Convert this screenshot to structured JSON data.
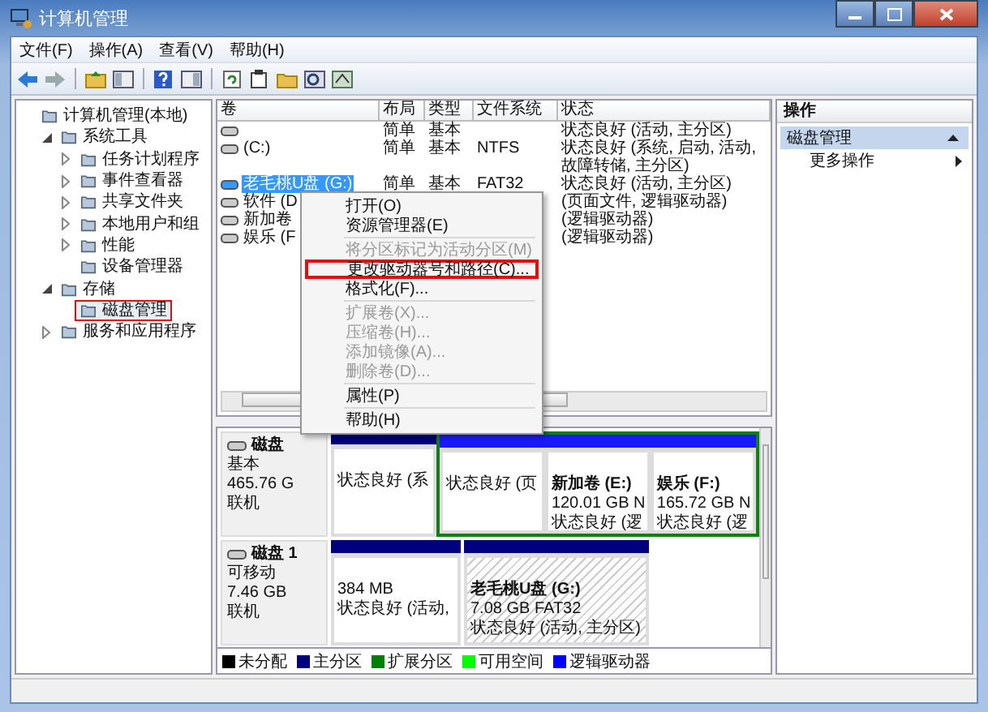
{
  "window": {
    "title": "计算机管理"
  },
  "menu_bar": [
    "文件(F)",
    "操作(A)",
    "查看(V)",
    "帮助(H)"
  ],
  "tree": [
    {
      "label": "计算机管理(本地)",
      "selected": false,
      "children": [
        {
          "label": "系统工具",
          "expanded": true,
          "selected": false,
          "children": [
            {
              "label": "任务计划程序",
              "expanded": false,
              "selected": false
            },
            {
              "label": "事件查看器",
              "expanded": false,
              "selected": false
            },
            {
              "label": "共享文件夹",
              "expanded": false,
              "selected": false
            },
            {
              "label": "本地用户和组",
              "expanded": false,
              "selected": false
            },
            {
              "label": "性能",
              "expanded": false,
              "selected": false
            },
            {
              "label": "设备管理器",
              "selected": false
            }
          ]
        },
        {
          "label": "存储",
          "expanded": true,
          "selected": false,
          "children": [
            {
              "label": "磁盘管理",
              "selected": true
            }
          ]
        },
        {
          "label": "服务和应用程序",
          "expanded": false,
          "selected": false
        }
      ]
    }
  ],
  "volume_table": {
    "columns": [
      "卷",
      "布局",
      "类型",
      "文件系统",
      "状态"
    ],
    "rows": [
      {
        "layout": "简单",
        "type": "基本",
        "status": "状态良好 (活动, 主分区)",
        "selected": false
      },
      {
        "volume": "(C:)",
        "layout": "简单",
        "type": "基本",
        "file_system": "NTFS",
        "status": "状态良好 (系统, 启动, 活动, 故障转储, 主分区)",
        "selected": false
      },
      {
        "volume": "老毛桃U盘 (G:)",
        "layout": "简单",
        "type": "基本",
        "file_system": "FAT32",
        "status": "状态良好 (活动, 主分区)",
        "selected": true
      },
      {
        "volume": "软件 (D",
        "status": "(页面文件, 逻辑驱动器)",
        "selected": false
      },
      {
        "volume": "新加卷",
        "status": "(逻辑驱动器)",
        "selected": false
      },
      {
        "volume": "娱乐 (F",
        "status": "(逻辑驱动器)",
        "selected": false
      }
    ]
  },
  "context_menu": {
    "groups": [
      [
        {
          "label": "打开(O)",
          "disabled": false,
          "highlighted": false
        },
        {
          "label": "资源管理器(E)",
          "disabled": false,
          "highlighted": false
        }
      ],
      [
        {
          "label": "将分区标记为活动分区(M)",
          "disabled": true,
          "highlighted": false
        },
        {
          "label": "更改驱动器号和路径(C)...",
          "disabled": false,
          "highlighted": true
        },
        {
          "label": "格式化(F)...",
          "disabled": false,
          "highlighted": false
        }
      ],
      [
        {
          "label": "扩展卷(X)...",
          "disabled": true,
          "highlighted": false
        },
        {
          "label": "压缩卷(H)...",
          "disabled": true,
          "highlighted": false
        },
        {
          "label": "添加镜像(A)...",
          "disabled": true,
          "highlighted": false
        },
        {
          "label": "删除卷(D)...",
          "disabled": true,
          "highlighted": false
        }
      ],
      [
        {
          "label": "属性(P)",
          "disabled": false,
          "highlighted": false
        }
      ],
      [
        {
          "label": "帮助(H)",
          "disabled": false,
          "highlighted": false
        }
      ]
    ]
  },
  "disks": [
    {
      "name": "磁盘",
      "type": "基本",
      "size": "465.76 G",
      "status": "联机",
      "partitions": [
        {
          "kind": "primary",
          "selected": false,
          "lines": [
            "状态良好 (系"
          ]
        },
        {
          "kind": "logical",
          "selected": false,
          "lines": [
            "状态良好 (页"
          ]
        },
        {
          "kind": "logical",
          "selected": false,
          "title": "新加卷  (E:)",
          "lines": [
            "120.01 GB N",
            "状态良好 (逻"
          ]
        },
        {
          "kind": "logical",
          "selected": false,
          "title": "娱乐  (F:)",
          "lines": [
            "165.72 GB N",
            "状态良好 (逻"
          ]
        }
      ]
    },
    {
      "name": "磁盘 1",
      "type": "可移动",
      "size": "7.46 GB",
      "status": "联机",
      "partitions": [
        {
          "kind": "primary",
          "selected": false,
          "lines": [
            "384 MB",
            "状态良好 (活动,"
          ]
        },
        {
          "kind": "primary",
          "selected": true,
          "title": "老毛桃U盘  (G:)",
          "lines": [
            "7.08 GB FAT32",
            "状态良好 (活动, 主分区)"
          ]
        }
      ]
    }
  ],
  "legend": [
    {
      "label": "未分配",
      "color": "#000000"
    },
    {
      "label": "主分区",
      "color": "#000080"
    },
    {
      "label": "扩展分区",
      "color": "#008000"
    },
    {
      "label": "可用空间",
      "color": "#00ff00"
    },
    {
      "label": "逻辑驱动器",
      "color": "#0000ff"
    }
  ],
  "actions": {
    "header": "操作",
    "sections": [
      {
        "title": "磁盘管理",
        "expanded": true,
        "items": [
          "更多操作"
        ]
      }
    ]
  }
}
